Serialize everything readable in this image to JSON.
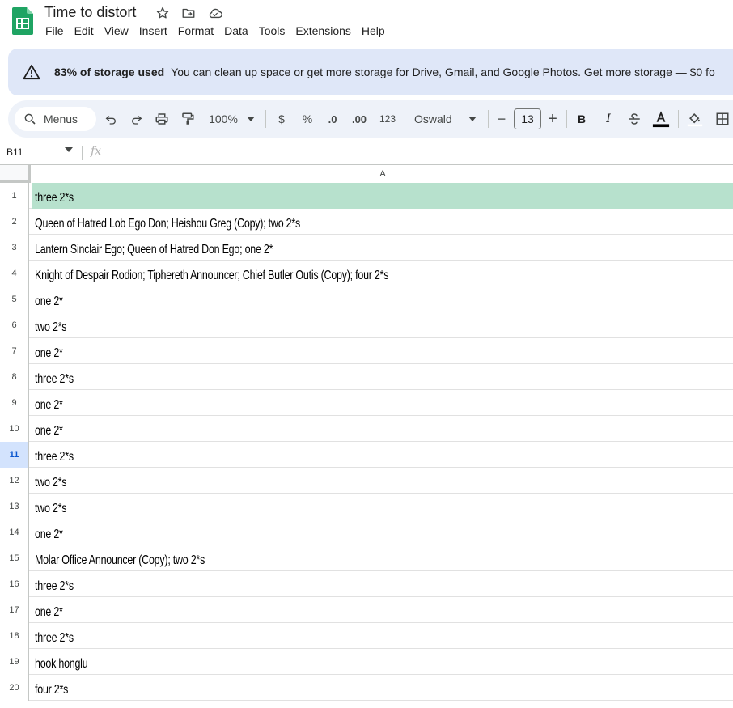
{
  "app": {
    "doc_title": "Time to distort",
    "menus": [
      "File",
      "Edit",
      "View",
      "Insert",
      "Format",
      "Data",
      "Tools",
      "Extensions",
      "Help"
    ]
  },
  "banner": {
    "bold": "83% of storage used",
    "message": "You can clean up space or get more storage for Drive, Gmail, and Google Photos. Get more storage — $0 fo"
  },
  "toolbar": {
    "search_placeholder": "Menus",
    "zoom": "100%",
    "currency": "$",
    "percent": "%",
    "decrease_decimal": ".0",
    "increase_decimal": ".00",
    "number_format": "123",
    "font": "Oswald",
    "font_size": "13",
    "minus": "−",
    "plus": "+",
    "bold": "B",
    "italic": "I"
  },
  "formula_bar": {
    "cell_ref": "B11",
    "fx": "fx"
  },
  "grid": {
    "column_header": "A",
    "active_row": 11,
    "highlight_color": "#b7e1cd",
    "rows": [
      {
        "num": "1",
        "value": "three 2*s"
      },
      {
        "num": "2",
        "value": "Queen of Hatred Lob Ego Don; Heishou Greg (Copy); two 2*s"
      },
      {
        "num": "3",
        "value": "Lantern Sinclair Ego; Queen of Hatred Don Ego; one 2*"
      },
      {
        "num": "4",
        "value": "Knight of Despair Rodion; Tiphereth Announcer; Chief Butler Outis (Copy); four 2*s"
      },
      {
        "num": "5",
        "value": "one 2*"
      },
      {
        "num": "6",
        "value": "two 2*s"
      },
      {
        "num": "7",
        "value": "one 2*"
      },
      {
        "num": "8",
        "value": "three 2*s"
      },
      {
        "num": "9",
        "value": "one 2*"
      },
      {
        "num": "10",
        "value": "one 2*"
      },
      {
        "num": "11",
        "value": "three 2*s"
      },
      {
        "num": "12",
        "value": "two 2*s"
      },
      {
        "num": "13",
        "value": "two 2*s"
      },
      {
        "num": "14",
        "value": "one 2*"
      },
      {
        "num": "15",
        "value": "Molar Office Announcer (Copy); two 2*s"
      },
      {
        "num": "16",
        "value": "three 2*s"
      },
      {
        "num": "17",
        "value": "one 2*"
      },
      {
        "num": "18",
        "value": "three 2*s"
      },
      {
        "num": "19",
        "value": "hook honglu"
      },
      {
        "num": "20",
        "value": "four 2*s"
      }
    ]
  }
}
